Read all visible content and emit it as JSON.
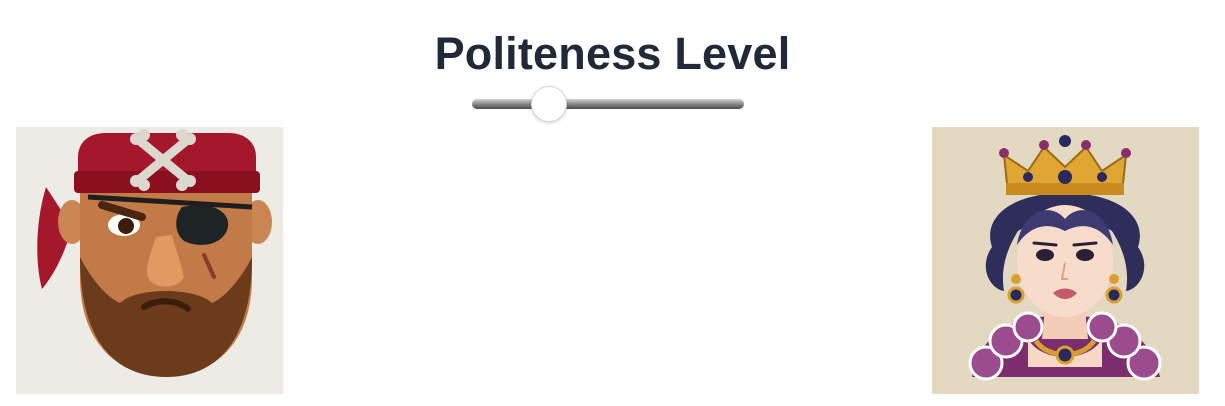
{
  "header": {
    "title": "Politeness Level"
  },
  "slider": {
    "value_fraction": 0.28
  },
  "avatars": {
    "left": {
      "icon": "pirate-icon",
      "background": "#ecebe6"
    },
    "right": {
      "icon": "queen-icon",
      "background": "#e3d8c2"
    }
  },
  "colors": {
    "title": "#1f2937",
    "bandana": "#a5172b",
    "crown": "#e0a634",
    "queen_dress": "#7c2d6e"
  }
}
